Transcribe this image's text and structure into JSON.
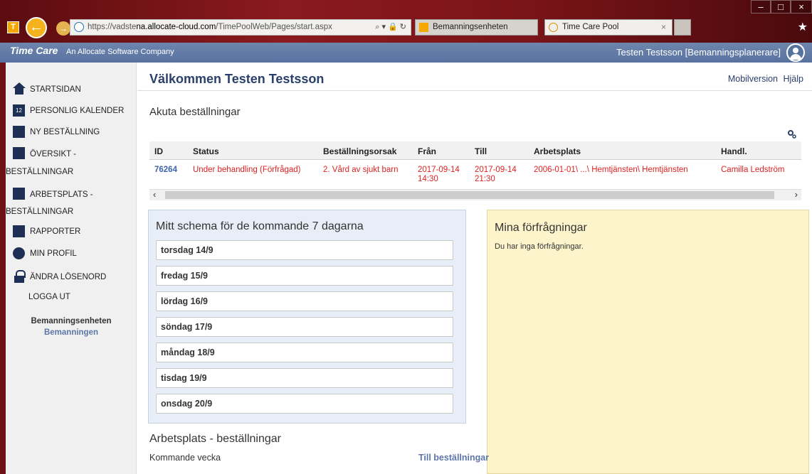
{
  "browser": {
    "address_prefix": "https://vadste",
    "address_domain": "na.allocate-cloud.com",
    "address_path": "/TimePoolWeb/Pages/start.aspx",
    "tabs": [
      {
        "label": "Bemanningsenheten"
      },
      {
        "label": "Time Care Pool"
      }
    ]
  },
  "app": {
    "logo": "Time Care",
    "logo_sub": "An Allocate Software Company",
    "user": "Testen Testsson [Bemanningsplanerare]"
  },
  "sidebar": {
    "items": [
      {
        "label": "STARTSIDAN",
        "icon": "home-icon"
      },
      {
        "label": "PERSONLIG KALENDER",
        "icon": "calendar-icon"
      },
      {
        "label": "NY BESTÄLLNING",
        "icon": "new-document-icon"
      },
      {
        "label": "ÖVERSIKT -",
        "label2": "BESTÄLLNINGAR",
        "icon": "checklist-icon"
      },
      {
        "label": "ARBETSPLATS -",
        "label2": "BESTÄLLNINGAR",
        "icon": "list-icon"
      },
      {
        "label": "RAPPORTER",
        "icon": "report-icon"
      },
      {
        "label": "MIN PROFIL",
        "icon": "profile-icon"
      },
      {
        "label": "ÄNDRA LÖSENORD",
        "icon": "lock-icon"
      },
      {
        "label": "LOGGA UT"
      }
    ],
    "unit_name": "Bemanningsenheten",
    "unit_sub": "Bemanningen"
  },
  "main": {
    "welcome": "Välkommen Testen Testsson",
    "links": {
      "mobile": "Mobilversion",
      "help": "Hjälp"
    },
    "urgent_title": "Akuta beställningar",
    "table": {
      "headers": [
        "ID",
        "Status",
        "Beställningsorsak",
        "Från",
        "Till",
        "Arbetsplats",
        "Handl."
      ],
      "rows": [
        {
          "id": "76264",
          "status": "Under behandling (Förfrågad)",
          "reason": "2. Vård av sjukt barn",
          "from_date": "2017-09-14",
          "from_time": "14:30",
          "to_date": "2017-09-14",
          "to_time": "21:30",
          "workplace": "2006-01-01\\ ...\\ Hemtjänsten\\ Hemtjänsten",
          "handler": "Camilla Ledström"
        }
      ]
    },
    "schedule": {
      "title": "Mitt schema för de kommande 7 dagarna",
      "days": [
        "torsdag 14/9",
        "fredag 15/9",
        "lördag 16/9",
        "söndag 17/9",
        "måndag 18/9",
        "tisdag 19/9",
        "onsdag 20/9"
      ]
    },
    "requests": {
      "title": "Mina förfrågningar",
      "empty_text": "Du har inga förfrågningar."
    },
    "workplace_orders": {
      "title": "Arbetsplats - beställningar",
      "subtitle": "Kommande vecka",
      "link": "Till beställningar"
    }
  }
}
